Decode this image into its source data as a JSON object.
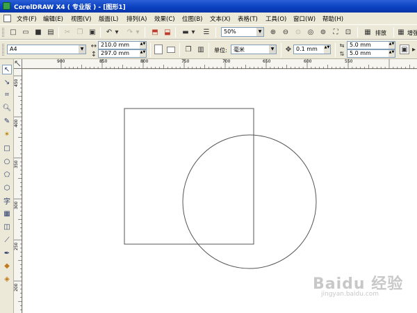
{
  "window": {
    "title": "CorelDRAW X4 ( 专业版 ) - [图形1]",
    "app_icon": "coreldraw-balloon-icon"
  },
  "menu": {
    "document_icon": "document-icon",
    "items": [
      "文件(F)",
      "编辑(E)",
      "视图(V)",
      "版面(L)",
      "排列(A)",
      "效果(C)",
      "位图(B)",
      "文本(X)",
      "表格(T)",
      "工具(O)",
      "窗口(W)",
      "帮助(H)"
    ]
  },
  "standard_toolbar": {
    "zoom_level": "50%",
    "arrange_label": "排放",
    "launch_label": "增强"
  },
  "property_bar": {
    "paper_size": "A4",
    "width": "210.0 mm",
    "height": "297.0 mm",
    "units_label": "单位:",
    "units_value": "毫米",
    "nudge": "0.1 mm",
    "dup_x": "5.0 mm",
    "dup_y": "5.0 mm"
  },
  "rulers": {
    "horizontal_ticks": [
      "900",
      "850",
      "800",
      "750",
      "700",
      "650",
      "600",
      "550"
    ],
    "vertical_ticks": [
      "450",
      "400",
      "350",
      "300",
      "250",
      "200"
    ]
  },
  "toolbox": {
    "tools": [
      "pick-tool-icon",
      "shape-tool-icon",
      "crop-tool-icon",
      "zoom-tool-icon",
      "freehand-tool-icon",
      "smart-fill-icon",
      "rectangle-tool-icon",
      "ellipse-tool-icon",
      "polygon-tool-icon",
      "basic-shapes-icon",
      "text-tool-icon",
      "table-tool-icon",
      "interactive-blend-icon",
      "eyedropper-icon",
      "outline-pen-icon",
      "fill-tool-icon",
      "interactive-fill-icon"
    ],
    "text_tool_glyph": "字"
  },
  "watermark": {
    "main": "Baidu 经验",
    "sub": "jingyan.baidu.com"
  }
}
